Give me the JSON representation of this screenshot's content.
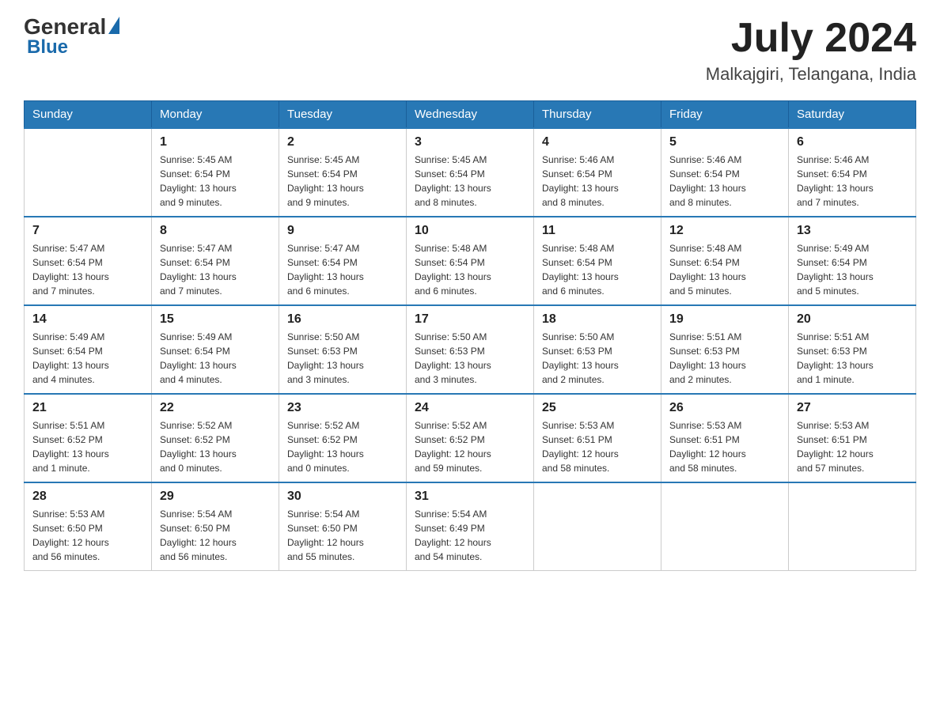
{
  "header": {
    "logo": {
      "general": "General",
      "arrow_symbol": "▲",
      "blue": "Blue"
    },
    "month_year": "July 2024",
    "location": "Malkajgiri, Telangana, India"
  },
  "weekdays": [
    "Sunday",
    "Monday",
    "Tuesday",
    "Wednesday",
    "Thursday",
    "Friday",
    "Saturday"
  ],
  "weeks": [
    [
      {
        "day": "",
        "info": ""
      },
      {
        "day": "1",
        "info": "Sunrise: 5:45 AM\nSunset: 6:54 PM\nDaylight: 13 hours\nand 9 minutes."
      },
      {
        "day": "2",
        "info": "Sunrise: 5:45 AM\nSunset: 6:54 PM\nDaylight: 13 hours\nand 9 minutes."
      },
      {
        "day": "3",
        "info": "Sunrise: 5:45 AM\nSunset: 6:54 PM\nDaylight: 13 hours\nand 8 minutes."
      },
      {
        "day": "4",
        "info": "Sunrise: 5:46 AM\nSunset: 6:54 PM\nDaylight: 13 hours\nand 8 minutes."
      },
      {
        "day": "5",
        "info": "Sunrise: 5:46 AM\nSunset: 6:54 PM\nDaylight: 13 hours\nand 8 minutes."
      },
      {
        "day": "6",
        "info": "Sunrise: 5:46 AM\nSunset: 6:54 PM\nDaylight: 13 hours\nand 7 minutes."
      }
    ],
    [
      {
        "day": "7",
        "info": "Sunrise: 5:47 AM\nSunset: 6:54 PM\nDaylight: 13 hours\nand 7 minutes."
      },
      {
        "day": "8",
        "info": "Sunrise: 5:47 AM\nSunset: 6:54 PM\nDaylight: 13 hours\nand 7 minutes."
      },
      {
        "day": "9",
        "info": "Sunrise: 5:47 AM\nSunset: 6:54 PM\nDaylight: 13 hours\nand 6 minutes."
      },
      {
        "day": "10",
        "info": "Sunrise: 5:48 AM\nSunset: 6:54 PM\nDaylight: 13 hours\nand 6 minutes."
      },
      {
        "day": "11",
        "info": "Sunrise: 5:48 AM\nSunset: 6:54 PM\nDaylight: 13 hours\nand 6 minutes."
      },
      {
        "day": "12",
        "info": "Sunrise: 5:48 AM\nSunset: 6:54 PM\nDaylight: 13 hours\nand 5 minutes."
      },
      {
        "day": "13",
        "info": "Sunrise: 5:49 AM\nSunset: 6:54 PM\nDaylight: 13 hours\nand 5 minutes."
      }
    ],
    [
      {
        "day": "14",
        "info": "Sunrise: 5:49 AM\nSunset: 6:54 PM\nDaylight: 13 hours\nand 4 minutes."
      },
      {
        "day": "15",
        "info": "Sunrise: 5:49 AM\nSunset: 6:54 PM\nDaylight: 13 hours\nand 4 minutes."
      },
      {
        "day": "16",
        "info": "Sunrise: 5:50 AM\nSunset: 6:53 PM\nDaylight: 13 hours\nand 3 minutes."
      },
      {
        "day": "17",
        "info": "Sunrise: 5:50 AM\nSunset: 6:53 PM\nDaylight: 13 hours\nand 3 minutes."
      },
      {
        "day": "18",
        "info": "Sunrise: 5:50 AM\nSunset: 6:53 PM\nDaylight: 13 hours\nand 2 minutes."
      },
      {
        "day": "19",
        "info": "Sunrise: 5:51 AM\nSunset: 6:53 PM\nDaylight: 13 hours\nand 2 minutes."
      },
      {
        "day": "20",
        "info": "Sunrise: 5:51 AM\nSunset: 6:53 PM\nDaylight: 13 hours\nand 1 minute."
      }
    ],
    [
      {
        "day": "21",
        "info": "Sunrise: 5:51 AM\nSunset: 6:52 PM\nDaylight: 13 hours\nand 1 minute."
      },
      {
        "day": "22",
        "info": "Sunrise: 5:52 AM\nSunset: 6:52 PM\nDaylight: 13 hours\nand 0 minutes."
      },
      {
        "day": "23",
        "info": "Sunrise: 5:52 AM\nSunset: 6:52 PM\nDaylight: 13 hours\nand 0 minutes."
      },
      {
        "day": "24",
        "info": "Sunrise: 5:52 AM\nSunset: 6:52 PM\nDaylight: 12 hours\nand 59 minutes."
      },
      {
        "day": "25",
        "info": "Sunrise: 5:53 AM\nSunset: 6:51 PM\nDaylight: 12 hours\nand 58 minutes."
      },
      {
        "day": "26",
        "info": "Sunrise: 5:53 AM\nSunset: 6:51 PM\nDaylight: 12 hours\nand 58 minutes."
      },
      {
        "day": "27",
        "info": "Sunrise: 5:53 AM\nSunset: 6:51 PM\nDaylight: 12 hours\nand 57 minutes."
      }
    ],
    [
      {
        "day": "28",
        "info": "Sunrise: 5:53 AM\nSunset: 6:50 PM\nDaylight: 12 hours\nand 56 minutes."
      },
      {
        "day": "29",
        "info": "Sunrise: 5:54 AM\nSunset: 6:50 PM\nDaylight: 12 hours\nand 56 minutes."
      },
      {
        "day": "30",
        "info": "Sunrise: 5:54 AM\nSunset: 6:50 PM\nDaylight: 12 hours\nand 55 minutes."
      },
      {
        "day": "31",
        "info": "Sunrise: 5:54 AM\nSunset: 6:49 PM\nDaylight: 12 hours\nand 54 minutes."
      },
      {
        "day": "",
        "info": ""
      },
      {
        "day": "",
        "info": ""
      },
      {
        "day": "",
        "info": ""
      }
    ]
  ]
}
